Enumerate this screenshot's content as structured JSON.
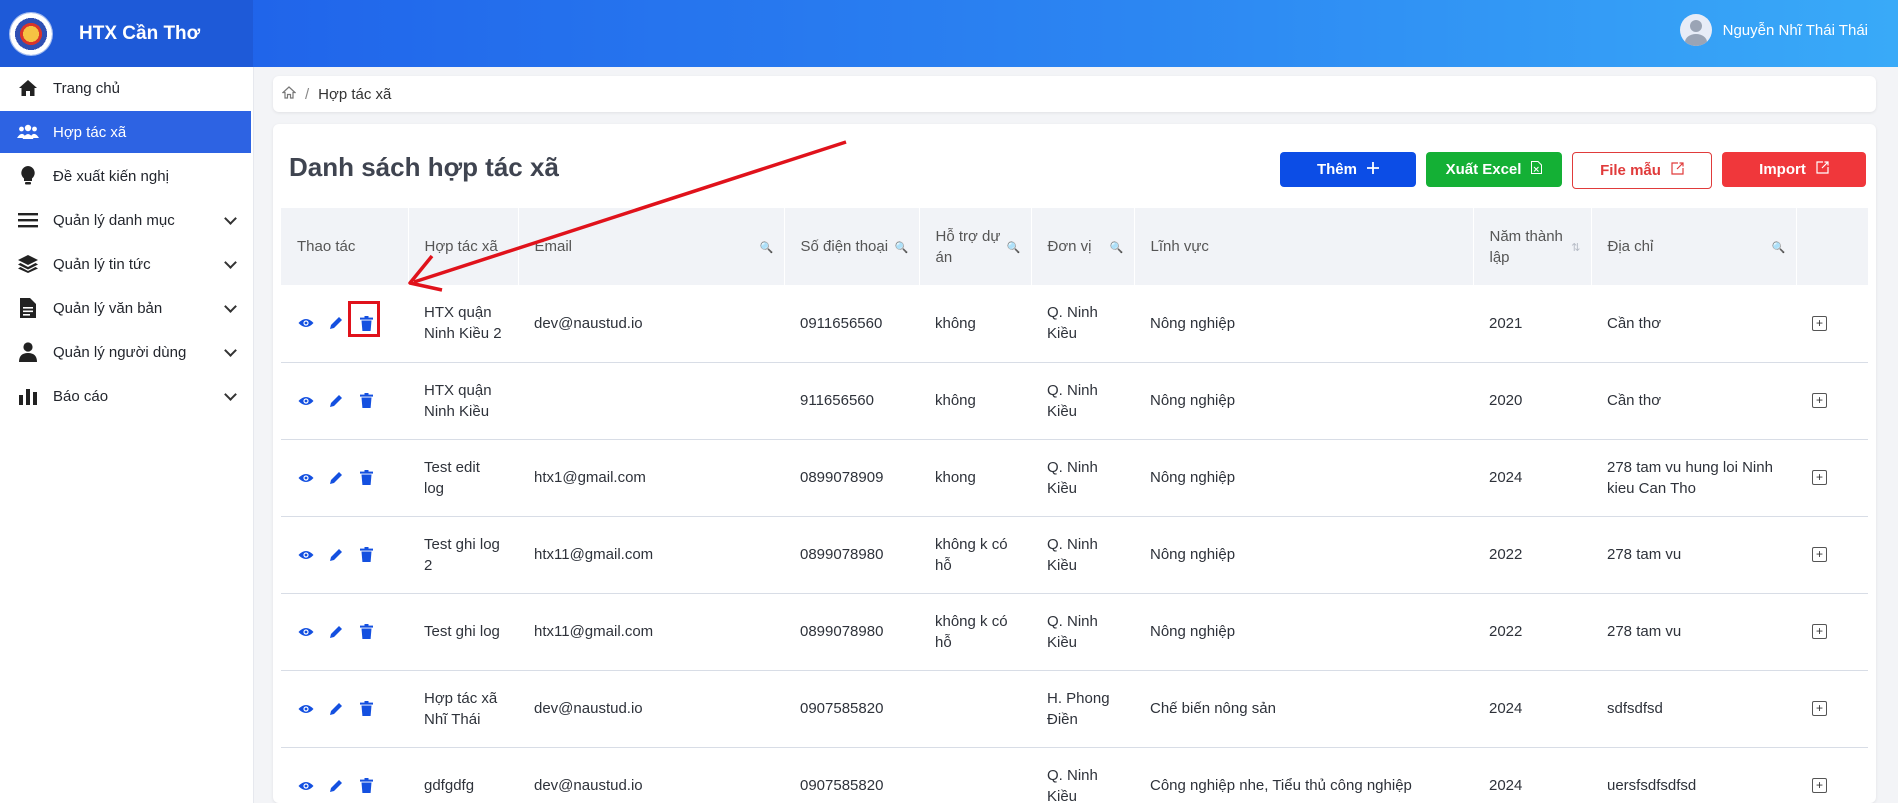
{
  "app": {
    "title": "HTX Cần Thơ",
    "user_name": "Nguyễn Nhĩ Thái Thái"
  },
  "sidebar": {
    "items": [
      {
        "label": "Trang chủ",
        "icon": "home-icon",
        "active": false,
        "chevron": false
      },
      {
        "label": "Hợp tác xã",
        "icon": "users-icon",
        "active": true,
        "chevron": false
      },
      {
        "label": "Đề xuất kiến nghị",
        "icon": "lightbulb-icon",
        "active": false,
        "chevron": false
      },
      {
        "label": "Quản lý danh mục",
        "icon": "list-icon",
        "active": false,
        "chevron": true
      },
      {
        "label": "Quản lý tin tức",
        "icon": "layers-icon",
        "active": false,
        "chevron": true
      },
      {
        "label": "Quản lý văn bản",
        "icon": "document-icon",
        "active": false,
        "chevron": true
      },
      {
        "label": "Quản lý người dùng",
        "icon": "user-icon",
        "active": false,
        "chevron": true
      },
      {
        "label": "Báo cáo",
        "icon": "bar-chart-icon",
        "active": false,
        "chevron": true
      }
    ]
  },
  "breadcrumb": {
    "current": "Hợp tác xã"
  },
  "page": {
    "title": "Danh sách hợp tác xã",
    "buttons": {
      "add": "Thêm",
      "export_excel": "Xuất Excel",
      "template_file": "File mẫu",
      "import": "Import"
    }
  },
  "table": {
    "headers": [
      "Thao tác",
      "Hợp tác xã",
      "Email",
      "Số điện thoại",
      "Hỗ trợ dự án",
      "Đơn vị",
      "Lĩnh vực",
      "Năm thành lập",
      "Địa chỉ"
    ],
    "rows": [
      {
        "name": "HTX quận Ninh Kiều 2",
        "email": "dev@naustud.io",
        "phone": "0911656560",
        "support": "không",
        "unit": "Q. Ninh Kiều",
        "field": "Nông nghiệp",
        "year": "2021",
        "address": "Cần thơ"
      },
      {
        "name": "HTX quận Ninh Kiều",
        "email": "",
        "phone": "911656560",
        "support": "không",
        "unit": "Q. Ninh Kiều",
        "field": "Nông nghiệp",
        "year": "2020",
        "address": "Cần thơ"
      },
      {
        "name": "Test edit log",
        "email": "htx1@gmail.com",
        "phone": "0899078909",
        "support": "khong",
        "unit": "Q. Ninh Kiều",
        "field": "Nông nghiệp",
        "year": "2024",
        "address": "278 tam vu hung loi Ninh kieu Can Tho"
      },
      {
        "name": "Test ghi log 2",
        "email": "htx11@gmail.com",
        "phone": "0899078980",
        "support": "không k có hỗ",
        "unit": "Q. Ninh Kiều",
        "field": "Nông nghiệp",
        "year": "2022",
        "address": "278 tam vu"
      },
      {
        "name": "Test ghi log",
        "email": "htx11@gmail.com",
        "phone": "0899078980",
        "support": "không k có hỗ",
        "unit": "Q. Ninh Kiều",
        "field": "Nông nghiệp",
        "year": "2022",
        "address": "278 tam vu"
      },
      {
        "name": "Hợp tác xã Nhĩ Thái",
        "email": "dev@naustud.io",
        "phone": "0907585820",
        "support": "",
        "unit": "H. Phong Điền",
        "field": "Chế biến nông sản",
        "year": "2024",
        "address": "sdfsdfsd"
      },
      {
        "name": "gdfgdfg",
        "email": "dev@naustud.io",
        "phone": "0907585820",
        "support": "",
        "unit": "Q. Ninh Kiều",
        "field": "Công nghiệp nhe, Tiểu thủ công nghiệp",
        "year": "2024",
        "address": "uersfsdfsdfsd"
      }
    ]
  },
  "colors": {
    "primary": "#0c4de6",
    "success": "#14b035",
    "danger": "#f0373b",
    "annotation": "#e0121b"
  }
}
